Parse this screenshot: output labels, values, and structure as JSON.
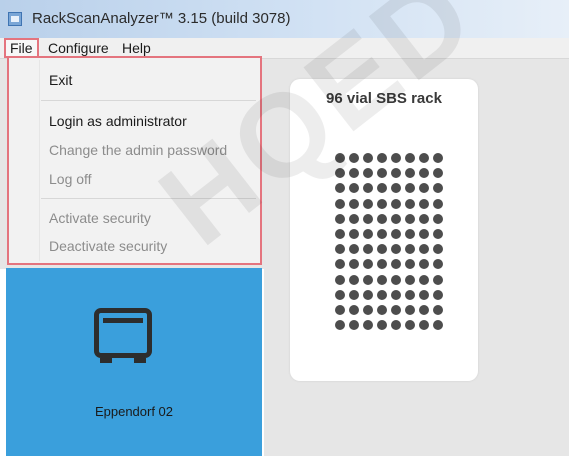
{
  "window": {
    "title": "RackScanAnalyzer™ 3.15 (build 3078)"
  },
  "menubar": {
    "file": "File",
    "configure": "Configure",
    "help": "Help"
  },
  "file_menu": {
    "items": [
      {
        "label": "Exit",
        "enabled": true
      },
      {
        "label": "Login as administrator",
        "enabled": true
      },
      {
        "label": "Change the admin password",
        "enabled": false
      },
      {
        "label": "Log off",
        "enabled": false
      },
      {
        "label": "Activate security",
        "enabled": false
      },
      {
        "label": "Deactivate security",
        "enabled": false
      }
    ]
  },
  "rack": {
    "title": "96 vial SBS rack",
    "rows": 12,
    "cols": 8
  },
  "device": {
    "label": "Eppendorf 02"
  },
  "watermark": {
    "text": "HQED"
  },
  "colors": {
    "accent": "#3a9fdc",
    "highlight": "#e4747e"
  }
}
